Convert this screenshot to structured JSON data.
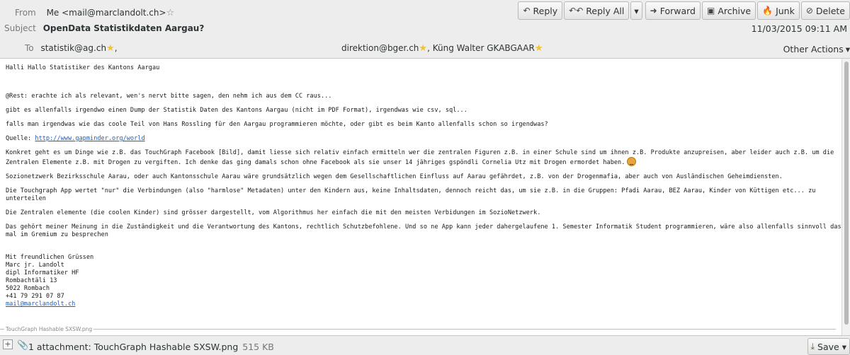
{
  "header": {
    "from_label": "From",
    "from_value": "Me <mail@marclandolt.ch>",
    "subject_label": "Subject",
    "subject_value": "OpenData Statistikdaten Aargau?",
    "to_label": "To",
    "to_first": "statistik@ag.ch",
    "to_first_sep": ",",
    "to_second": "direktion@bger.ch",
    "to_second_sep": ",",
    "to_third": "Küng Walter GKABGAAR",
    "date": "11/03/2015 09:11 AM",
    "other_actions": "Other Actions"
  },
  "toolbar": {
    "reply": "Reply",
    "reply_all": "Reply All",
    "forward": "Forward",
    "archive": "Archive",
    "junk": "Junk",
    "delete": "Delete"
  },
  "body": {
    "greeting": "Halli Hallo Statistiker des Kantons Aargau",
    "p1": "@Rest: erachte ich als relevant, wen's nervt bitte sagen, den nehm ich aus dem CC raus...",
    "p2": "gibt es allenfalls irgendwo einen Dump der Statistik Daten des Kantons Aargau (nicht im PDF Format), irgendwas wie csv, sql...",
    "p3": "falls man irgendwas wie das coole Teil von Hans Rossling für den Aargau programmieren möchte, oder gibt es beim Kanto allenfalls schon so irgendwas?",
    "source_label": "Quelle: ",
    "source_link": "http://www.gapminder.org/world",
    "p4": "Konkret geht es um Dinge wie z.B. das TouchGraph Facebook [Bild], damit liesse sich relativ einfach ermitteln wer die zentralen Figuren z.B. in einer Schule sind um ihnen z.B. Produkte anzupreisen, aber leider auch z.B. um die Zentralen Elemente z.B. mit Drogen zu vergiften. Ich denke das ging damals schon ohne Facebook als sie unser 14 jähriges gspöndli Cornelia Utz mit Drogen ermordet haben.",
    "p5": "Sozionetzwerk Bezirksschule Aarau, oder auch Kantonsschule Aarau wäre grundsätzlich wegen dem Gesellschaftlichen Einfluss auf Aarau gefährdet, z.B. von der Drogenmafia, aber auch von Ausländischen Geheimdiensten.",
    "p6": "Die Touchgraph App wertet \"nur\" die Verbindungen (also \"harmlose\" Metadaten) unter den Kindern aus, keine Inhaltsdaten, dennoch reicht das, um sie z.B. in die Gruppen: Pfadi Aarau, BEZ Aarau, Kinder von Küttigen etc... zu unterteilen",
    "p7": "Die Zentralen elemente (die coolen Kinder) sind grösser dargestellt, vom Algorithmus her einfach die mit den meisten Verbidungen im SozioNetzwerk.",
    "p8": "Das gehört meiner Meinung in die Zuständigkeit und die Verantwortung des Kantons, rechtlich Schutzbefohlene. Und so ne App kann jeder dahergelaufene 1. Semester Informatik Student programmieren, wäre also allenfalls sinnvoll das mal im Gremium zu besprechen",
    "sig_lines": "Mit freundlichen Grüssen\nMarc jr. Landolt\ndipl Informatiker HF\nRombachtäli 13\n5022 Rombach\n+41 79 291 07 87",
    "sig_email": "mail@marclandolt.ch",
    "attachment_sep": "TouchGraph Hashable SXSW.png"
  },
  "footer": {
    "attachment_text": "1 attachment: TouchGraph Hashable SXSW.png",
    "attachment_size": "515 KB",
    "save": "Save"
  }
}
